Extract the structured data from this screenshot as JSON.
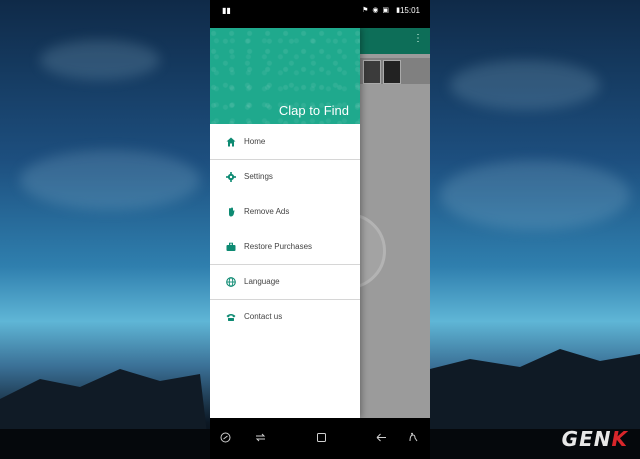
{
  "status_bar": {
    "time": "15:01"
  },
  "drawer": {
    "title": "Clap to Find",
    "items": [
      {
        "label": "Home",
        "icon": "home-icon"
      },
      {
        "label": "Settings",
        "icon": "gear-icon"
      },
      {
        "label": "Remove Ads",
        "icon": "hand-icon"
      },
      {
        "label": "Restore Purchases",
        "icon": "briefcase-icon"
      },
      {
        "label": "Language",
        "icon": "globe-icon"
      },
      {
        "label": "Contact us",
        "icon": "phone-icon"
      }
    ]
  },
  "nav_bar": {
    "buttons": [
      "assistant-icon",
      "recent-apps-icon",
      "home-button-icon",
      "back-icon",
      "gesture-icon"
    ]
  },
  "watermark": {
    "text_main": "GEN",
    "text_accent": "K"
  },
  "colors": {
    "accent": "#1fa98d",
    "icon": "#0d8a72",
    "watermark_accent": "#d9262b"
  }
}
